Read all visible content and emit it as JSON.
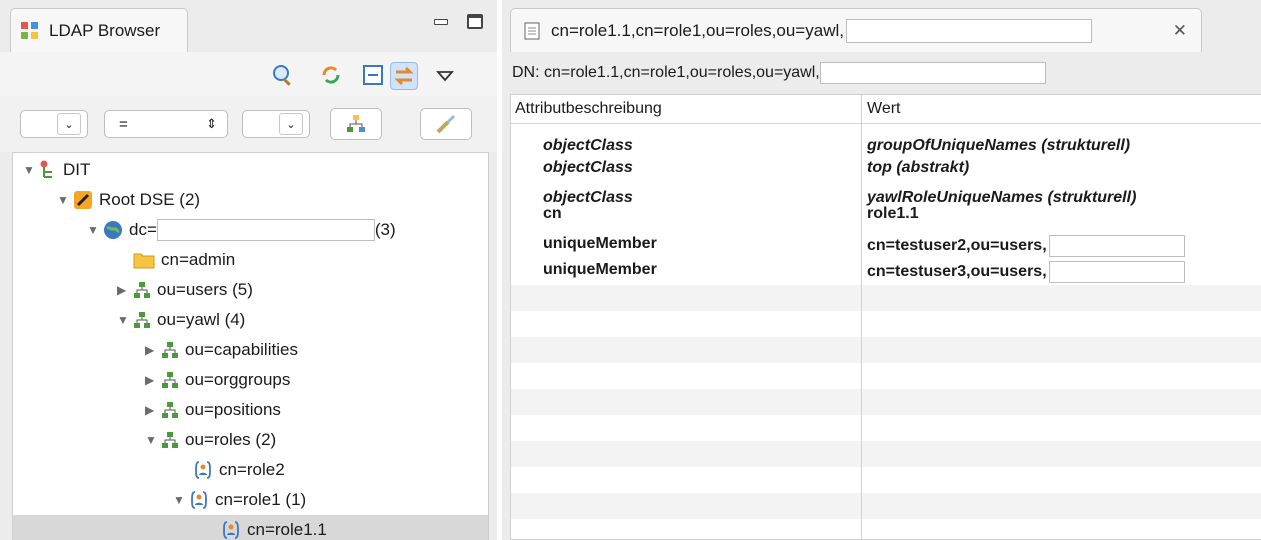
{
  "left_panel": {
    "tab_title": "LDAP Browser",
    "filter": {
      "attribute_value": "",
      "operator": "=",
      "value": ""
    }
  },
  "tree": {
    "nodes": [
      {
        "label": "DIT",
        "icon": "dit-icon",
        "twisty": "▼"
      },
      {
        "label": "Root DSE (2)",
        "icon": "root-dse-icon",
        "twisty": "▼"
      },
      {
        "label": "dc=",
        "suffix": "(3)",
        "icon": "globe-icon",
        "twisty": "▼"
      },
      {
        "label": "cn=admin",
        "icon": "folder-icon",
        "twisty": ""
      },
      {
        "label": "ou=users (5)",
        "icon": "org-unit-icon",
        "twisty": "▶"
      },
      {
        "label": "ou=yawl (4)",
        "icon": "org-unit-icon",
        "twisty": "▼"
      },
      {
        "label": "ou=capabilities",
        "icon": "org-unit-icon",
        "twisty": "▶"
      },
      {
        "label": "ou=orggroups",
        "icon": "org-unit-icon",
        "twisty": "▶"
      },
      {
        "label": "ou=positions",
        "icon": "org-unit-icon",
        "twisty": "▶"
      },
      {
        "label": "ou=roles (2)",
        "icon": "org-unit-icon",
        "twisty": "▼"
      },
      {
        "label": "cn=role2",
        "icon": "role-icon",
        "twisty": ""
      },
      {
        "label": "cn=role1 (1)",
        "icon": "role-icon",
        "twisty": "▼"
      },
      {
        "label": "cn=role1.1",
        "icon": "role-icon",
        "twisty": ""
      }
    ]
  },
  "editor": {
    "tab_title": "cn=role1.1,cn=role1,ou=roles,ou=yawl,",
    "dn_label": "DN: cn=role1.1,cn=role1,ou=roles,ou=yawl,",
    "columns": {
      "attribute": "Attributbeschreibung",
      "value": "Wert"
    },
    "rows": [
      {
        "attribute": "objectClass",
        "value": "groupOfUniqueNames (strukturell)",
        "italic": true
      },
      {
        "attribute": "objectClass",
        "value": "top (abstrakt)",
        "italic": true
      },
      {
        "attribute": "objectClass",
        "value": "yawlRoleUniqueNames (strukturell)",
        "italic": true
      },
      {
        "attribute": "cn",
        "value": "role1.1",
        "italic": false
      },
      {
        "attribute": "uniqueMember",
        "value": "cn=testuser2,ou=users,",
        "italic": false
      },
      {
        "attribute": "uniqueMember",
        "value": "cn=testuser3,ou=users,",
        "italic": false
      }
    ]
  },
  "colors": {
    "selection": "#d8d8d8",
    "panel_bg": "#ececec",
    "orgunit_green": "#4a9a3a",
    "folder_yellow": "#f6c342"
  }
}
